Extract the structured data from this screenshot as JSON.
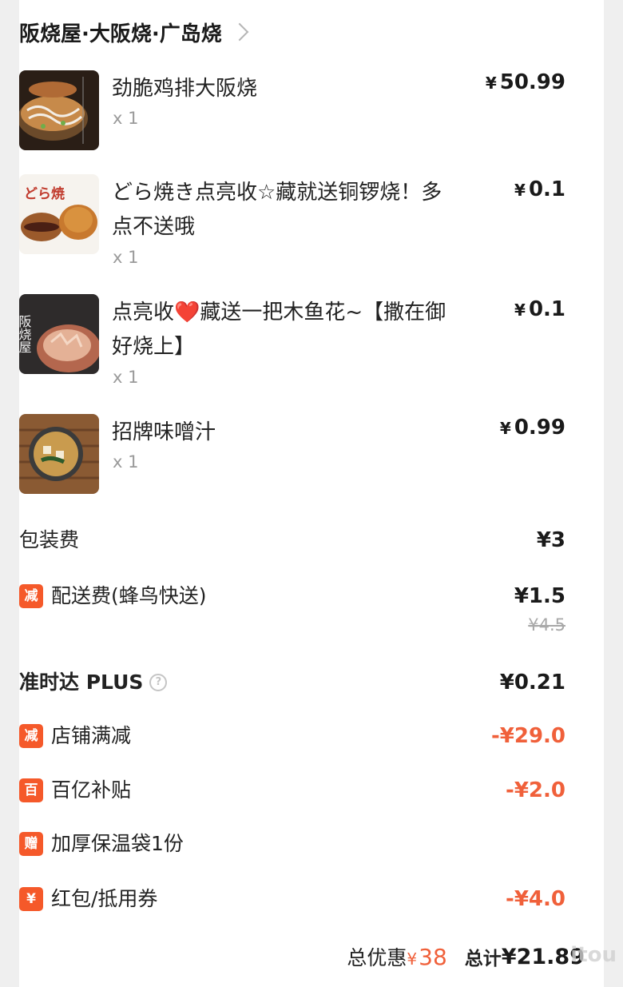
{
  "shop": {
    "name": "阪烧屋·大阪烧·广岛烧"
  },
  "items": [
    {
      "name": "劲脆鸡排大阪烧",
      "qty": "x 1",
      "currency": "¥",
      "price": "50.99"
    },
    {
      "name": "どら焼き点亮收☆藏就送铜锣烧！多点不送哦",
      "qty": "x 1",
      "currency": "¥",
      "price": "0.1"
    },
    {
      "name": "点亮收❤️藏送一把木鱼花~【撒在御好烧上】",
      "qty": "x 1",
      "currency": "¥",
      "price": "0.1"
    },
    {
      "name": "招牌味噌汁",
      "qty": "x 1",
      "currency": "¥",
      "price": "0.99"
    }
  ],
  "thumb_text": {
    "dorayaki": "どら焼",
    "hanshaoya": "阪烧屋"
  },
  "fees": {
    "packaging": {
      "label": "包装费",
      "value": "¥3"
    },
    "delivery": {
      "badge": "减",
      "label": "配送费(蜂鸟快送)",
      "value": "¥1.5",
      "original": "¥4.5"
    },
    "ontime": {
      "label": "准时达 PLUS",
      "help": "?",
      "value": "¥0.21"
    }
  },
  "discounts": [
    {
      "badge": "减",
      "label": "店铺满减",
      "value": "-¥29.0"
    },
    {
      "badge": "百",
      "label": "百亿补贴",
      "value": "-¥2.0"
    },
    {
      "badge": "赠",
      "label": "加厚保温袋1份",
      "value": ""
    },
    {
      "badge": "¥",
      "label": "红包/抵用券",
      "value": "-¥4.0"
    }
  ],
  "summary": {
    "discount_label": "总优惠",
    "discount_currency": "¥",
    "discount_value": "38",
    "total_label": "总计",
    "total_value": "¥21.89"
  },
  "watermark": "itou",
  "colors": {
    "accent_red": "#f0603a",
    "badge_orange": "#f5592a",
    "plus_blue": "#2f9ee6"
  }
}
